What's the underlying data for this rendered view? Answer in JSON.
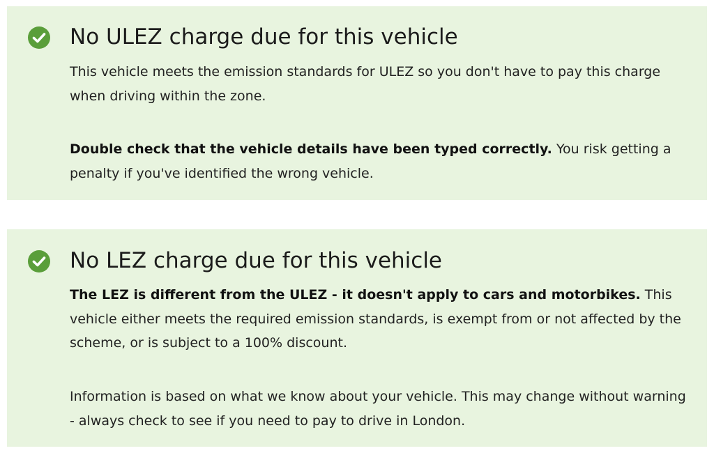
{
  "colors": {
    "panel_bg": "#e8f4df",
    "check_bg": "#5a9e3a",
    "text": "#222222"
  },
  "ulez": {
    "icon": "check-circle-icon",
    "title": "No ULEZ charge due for this vehicle",
    "p1": "This vehicle meets the emission standards for ULEZ so you don't have to pay this charge when driving within the zone.",
    "p2_bold": "Double check that the vehicle details have been typed correctly.",
    "p2_rest": " You risk getting a penalty if you've identified the wrong vehicle."
  },
  "lez": {
    "icon": "check-circle-icon",
    "title": "No LEZ charge due for this vehicle",
    "p1_bold": "The LEZ is different from the ULEZ - it doesn't apply to cars and motorbikes.",
    "p1_rest": " This vehicle either meets the required emission standards, is exempt from or not affected by the scheme, or is subject to a 100% discount.",
    "p2": "Information is based on what we know about your vehicle. This may change without warning - always check to see if you need to pay to drive in London."
  }
}
